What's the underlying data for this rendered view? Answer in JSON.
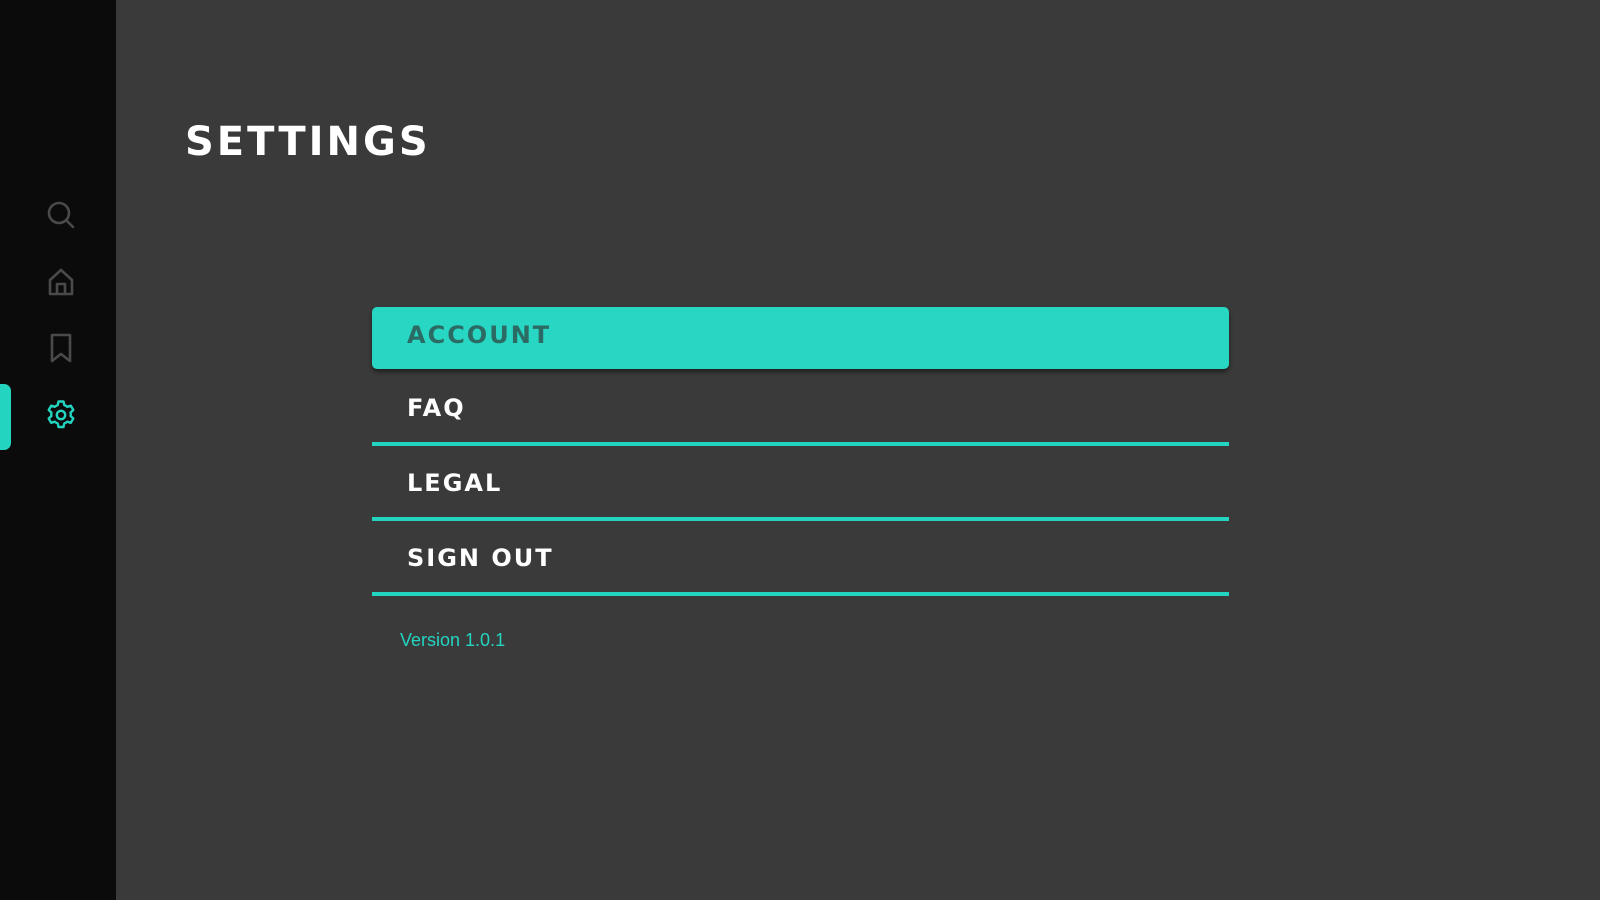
{
  "colors": {
    "accent": "#23d4c0",
    "background": "#3a3a3a",
    "sidebar": "#0b0b0b",
    "active_text": "#2c6b63",
    "icon_inactive": "#4a4a4a"
  },
  "sidebar": {
    "items": [
      {
        "icon": "search-icon",
        "active": false
      },
      {
        "icon": "home-icon",
        "active": false
      },
      {
        "icon": "bookmark-icon",
        "active": false
      },
      {
        "icon": "gear-icon",
        "active": true
      }
    ]
  },
  "page": {
    "title": "SETTINGS"
  },
  "menu": {
    "items": [
      {
        "label": "ACCOUNT",
        "active": true
      },
      {
        "label": "FAQ",
        "active": false
      },
      {
        "label": "LEGAL",
        "active": false
      },
      {
        "label": "SIGN OUT",
        "active": false
      }
    ]
  },
  "footer": {
    "version": "Version 1.0.1"
  }
}
